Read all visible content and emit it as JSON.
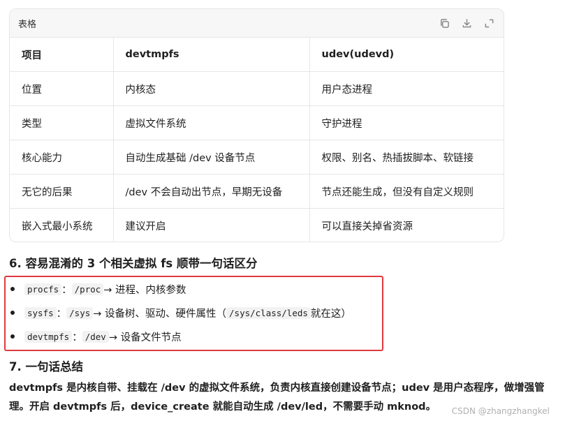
{
  "table": {
    "title": "表格",
    "toolbar": [
      "copy-icon",
      "download-icon",
      "expand-icon"
    ],
    "headers": [
      "项目",
      "devtmpfs",
      "udev(udevd)"
    ],
    "rows": [
      [
        "位置",
        "内核态",
        "用户态进程"
      ],
      [
        "类型",
        "虚拟文件系统",
        "守护进程"
      ],
      [
        "核心能力",
        "自动生成基础 /dev 设备节点",
        "权限、别名、热插拔脚本、软链接"
      ],
      [
        "无它的后果",
        "/dev 不会自动出节点，早期无设备",
        "节点还能生成，但没有自定义规则"
      ],
      [
        "嵌入式最小系统",
        "建议开启",
        "可以直接关掉省资源"
      ]
    ]
  },
  "section6": {
    "title": "6. 容易混淆的 3 个相关虚拟 fs 顺带一句话区分",
    "items": [
      {
        "name": "procfs",
        "sep": "：",
        "path": "/proc",
        "desc": " → 进程、内核参数"
      },
      {
        "name": "sysfs",
        "sep": "：",
        "path": "/sys",
        "desc": " → 设备树、驱动、硬件属性（",
        "path2": "/sys/class/leds",
        "desc2": " 就在这）"
      },
      {
        "name": "devtmpfs",
        "sep": "：",
        "path": "/dev",
        "desc": " → 设备文件节点"
      }
    ],
    "highlight_color": "#e0393e"
  },
  "section7": {
    "title": "7. 一句话总结",
    "summary": "devtmpfs 是内核自带、挂载在 /dev 的虚拟文件系统，负责内核直接创建设备节点；udev 是用户态程序，做增强管理。开启 devtmpfs 后，device_create 就能自动生成 /dev/led，不需要手动 mknod。"
  },
  "watermark": "CSDN @zhangzhangkel"
}
